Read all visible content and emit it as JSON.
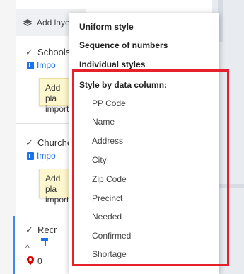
{
  "add_layer": {
    "label": "Add laye"
  },
  "layers": [
    {
      "name": "Schools",
      "import_label": "Impo",
      "tip": [
        "Add pla",
        "importi"
      ]
    },
    {
      "name": "Churche",
      "import_label": "Impo",
      "tip": [
        "Add pla",
        "importi"
      ]
    },
    {
      "name": "Recr",
      "marker_label": "0"
    }
  ],
  "menu": {
    "items": [
      "Uniform style",
      "Sequence of numbers",
      "Individual styles"
    ],
    "column_header": "Style by data column:",
    "columns": [
      "PP Code",
      "Name",
      "Address",
      "City",
      "Zip Code",
      "Precinct",
      "Needed",
      "Confirmed",
      "Shortage"
    ]
  },
  "colors": {
    "highlight": "#e5202b",
    "accent": "#1a73e8"
  }
}
